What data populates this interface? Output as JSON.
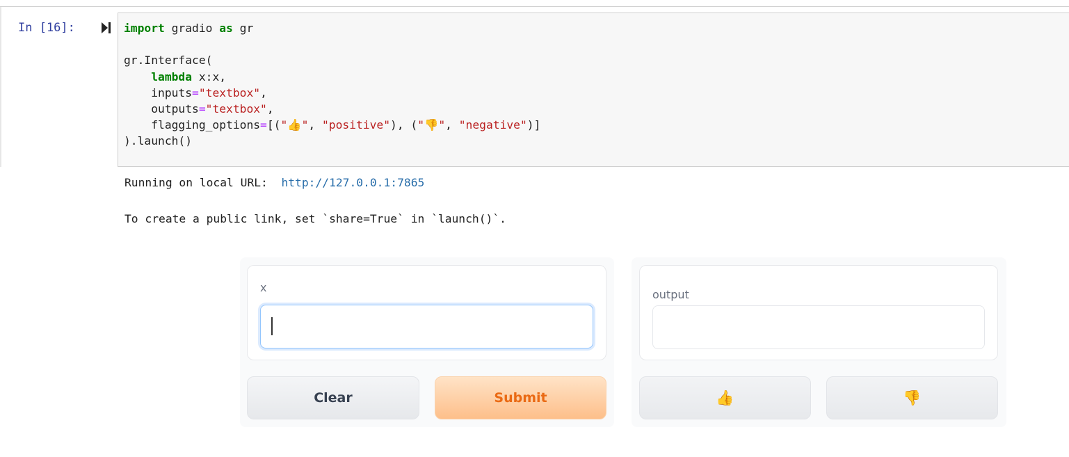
{
  "notebook": {
    "prompt": "In [16]:",
    "code": {
      "line1_kw1": "import",
      "line1_mid": " gradio ",
      "line1_kw2": "as",
      "line1_end": " gr",
      "line3": "gr.Interface(",
      "line4_kw": "lambda",
      "line4_rest": " x:x,",
      "line5_name": "    inputs",
      "line5_eq": "=",
      "line5_str": "\"textbox\"",
      "line5_end": ",",
      "line6_name": "    outputs",
      "line6_eq": "=",
      "line6_str": "\"textbox\"",
      "line6_end": ",",
      "line7_name": "    flagging_options",
      "line7_eq": "=",
      "line7_open": "[(",
      "line7_q1a": "\"",
      "line7_up": "👍",
      "line7_q1b": "\"",
      "line7_sep1": ", ",
      "line7_pos": "\"positive\"",
      "line7_mid": "), (",
      "line7_q2a": "\"",
      "line7_down": "👎",
      "line7_q2b": "\"",
      "line7_sep2": ", ",
      "line7_neg": "\"negative\"",
      "line7_close": ")]",
      "line8": ").launch()"
    },
    "output": {
      "running_prefix": "Running on local URL:  ",
      "url": "http://127.0.0.1:7865",
      "public_hint": "To create a public link, set `share=True` in `launch()`."
    }
  },
  "app": {
    "input_label": "x",
    "input_value": "",
    "output_label": "output",
    "output_value": "",
    "clear_label": "Clear",
    "submit_label": "Submit",
    "flag_positive": "👍",
    "flag_negative": "👎"
  },
  "colors": {
    "keyword": "#008000",
    "string": "#ba2121",
    "link": "#296eaa",
    "submit_text": "#ea6a14",
    "input_focus": "#93c5fd"
  }
}
